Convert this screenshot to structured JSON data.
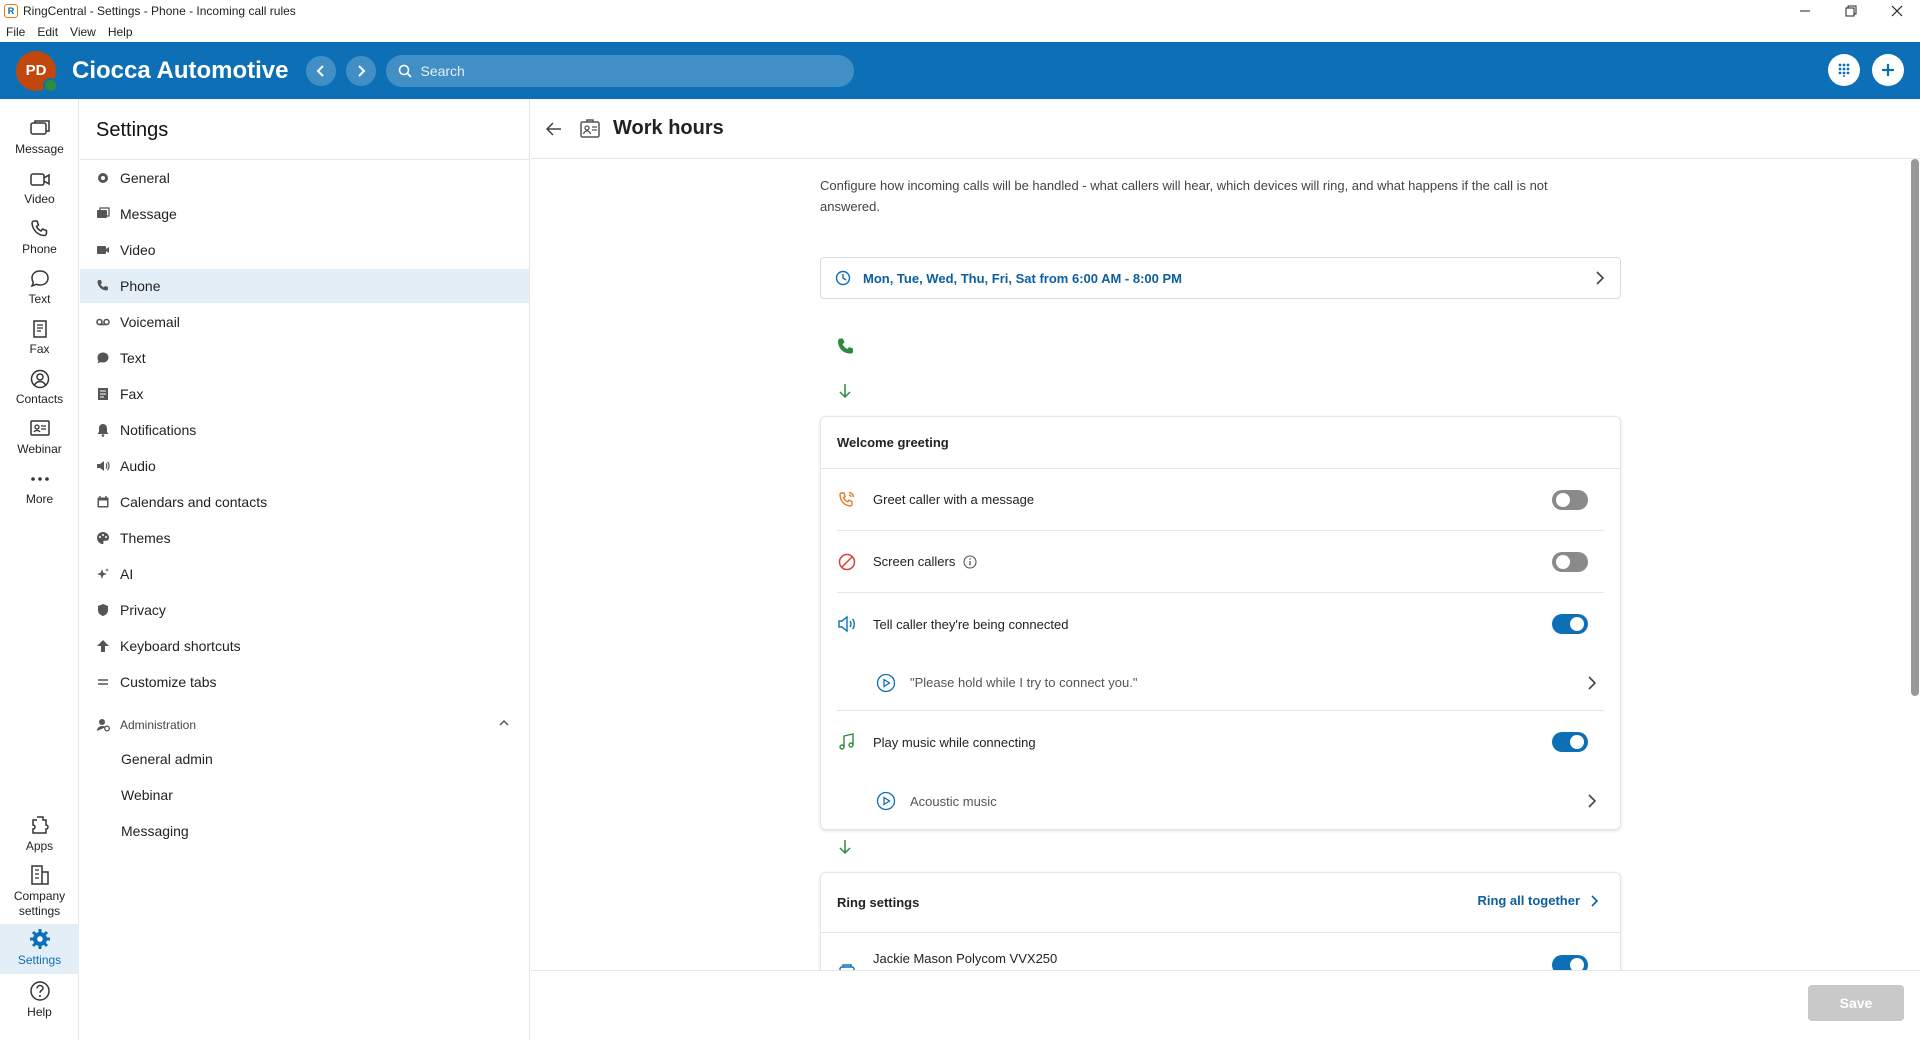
{
  "window": {
    "title": "RingCentral - Settings - Phone - Incoming call rules",
    "minimize": "—",
    "restore": "❐",
    "close": "✕"
  },
  "menu": [
    "File",
    "Edit",
    "View",
    "Help"
  ],
  "header": {
    "avatar_initials": "PD",
    "company": "Ciocca Automotive",
    "search_placeholder": "Search",
    "brand_color": "#0d70b6"
  },
  "rail": {
    "items": [
      {
        "label": "Message",
        "icon": "message-icon"
      },
      {
        "label": "Video",
        "icon": "video-icon"
      },
      {
        "label": "Phone",
        "icon": "phone-icon"
      },
      {
        "label": "Text",
        "icon": "text-icon"
      },
      {
        "label": "Fax",
        "icon": "fax-icon"
      },
      {
        "label": "Contacts",
        "icon": "contacts-icon"
      },
      {
        "label": "Webinar",
        "icon": "webinar-icon"
      },
      {
        "label": "More",
        "icon": "more-icon"
      }
    ],
    "bottom": [
      {
        "label": "Apps",
        "icon": "apps-icon"
      },
      {
        "label": "Company settings",
        "icon": "company-settings-icon"
      },
      {
        "label": "Settings",
        "icon": "settings-icon"
      },
      {
        "label": "Help",
        "icon": "help-icon"
      }
    ]
  },
  "settings": {
    "title": "Settings",
    "items": [
      {
        "label": "General"
      },
      {
        "label": "Message"
      },
      {
        "label": "Video"
      },
      {
        "label": "Phone"
      },
      {
        "label": "Voicemail"
      },
      {
        "label": "Text"
      },
      {
        "label": "Fax"
      },
      {
        "label": "Notifications"
      },
      {
        "label": "Audio"
      },
      {
        "label": "Calendars and contacts"
      },
      {
        "label": "Themes"
      },
      {
        "label": "AI"
      },
      {
        "label": "Privacy"
      },
      {
        "label": "Keyboard shortcuts"
      },
      {
        "label": "Customize tabs"
      }
    ],
    "admin": {
      "label": "Administration",
      "items": [
        "General admin",
        "Webinar",
        "Messaging"
      ]
    }
  },
  "page": {
    "title": "Work hours",
    "description": "Configure how incoming calls will be handled - what callers will hear, which devices will ring, and what happens if the call is not answered.",
    "schedule": "Mon, Tue, Wed, Thu, Fri, Sat from 6:00 AM - 8:00 PM",
    "welcome": {
      "title": "Welcome greeting",
      "greet_label": "Greet caller with a message",
      "greet_on": false,
      "screen_label": "Screen callers",
      "screen_on": false,
      "tell_label": "Tell caller they're being connected",
      "tell_on": true,
      "tell_message": "\"Please hold while I try to connect you.\"",
      "music_label": "Play music while connecting",
      "music_on": true,
      "music_choice": "Acoustic music"
    },
    "ring": {
      "title": "Ring settings",
      "mode": "Ring all together",
      "device": "Jackie Mason Polycom VVX250",
      "device_on": true
    },
    "save_label": "Save"
  }
}
